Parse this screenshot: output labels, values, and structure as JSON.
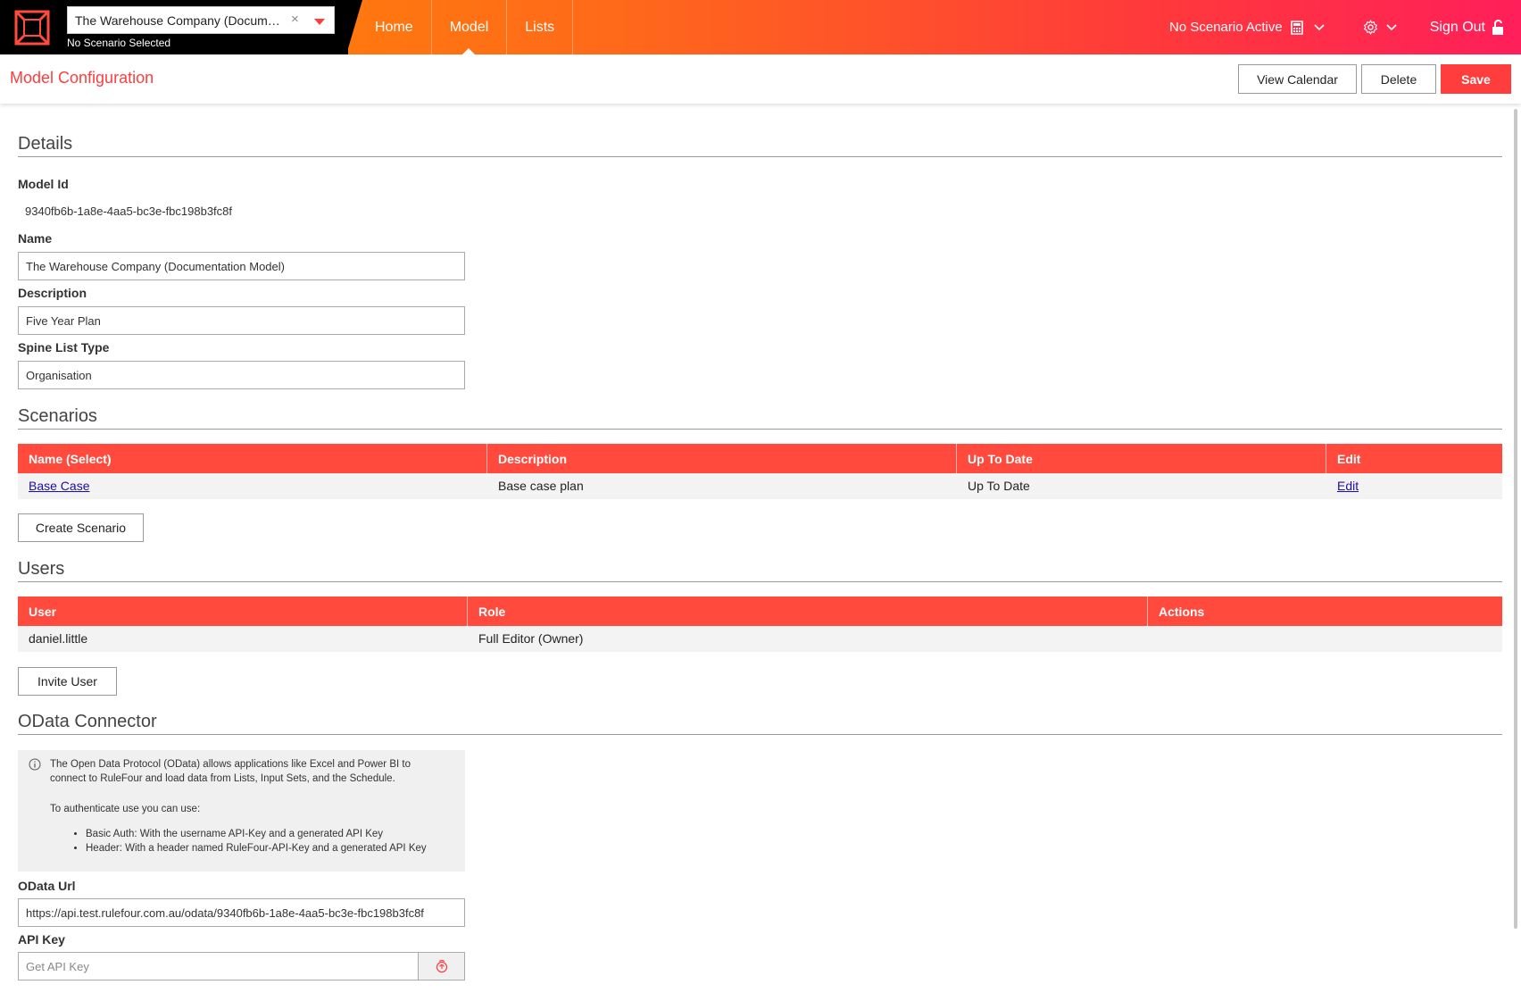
{
  "nav": {
    "model_selector_value": "The Warehouse Company (Documentation Model)",
    "model_selector_clear": "×",
    "scenario_subtitle": "No Scenario Selected",
    "tabs": [
      {
        "label": "Home",
        "active": false
      },
      {
        "label": "Model",
        "active": true
      },
      {
        "label": "Lists",
        "active": false
      }
    ],
    "scenario_status": "No Scenario Active",
    "sign_out": "Sign Out",
    "icons": [
      "calculator-icon",
      "chevron-down-icon",
      "gear-icon",
      "unlock-icon"
    ]
  },
  "page": {
    "title": "Model Configuration",
    "buttons": {
      "view_calendar": "View Calendar",
      "delete": "Delete",
      "save": "Save"
    }
  },
  "details": {
    "heading": "Details",
    "model_id_label": "Model Id",
    "model_id_value": "9340fb6b-1a8e-4aa5-bc3e-fbc198b3fc8f",
    "name_label": "Name",
    "name_value": "The Warehouse Company (Documentation Model)",
    "description_label": "Description",
    "description_value": "Five Year Plan",
    "spine_label": "Spine List Type",
    "spine_value": "Organisation"
  },
  "scenarios": {
    "heading": "Scenarios",
    "columns": [
      "Name (Select)",
      "Description",
      "Up To Date",
      "Edit"
    ],
    "rows": [
      {
        "name": "Base Case",
        "description": "Base case plan",
        "up_to_date": "Up To Date",
        "edit": "Edit"
      }
    ],
    "create_button": "Create Scenario"
  },
  "users": {
    "heading": "Users",
    "columns": [
      "User",
      "Role",
      "Actions"
    ],
    "rows": [
      {
        "user": "daniel.little",
        "role": "Full Editor (Owner)",
        "actions": ""
      }
    ],
    "invite_button": "Invite User"
  },
  "odata": {
    "heading": "OData Connector",
    "info_text": "The Open Data Protocol (OData) allows applications like Excel and Power BI to connect to RuleFour and load data from Lists, Input Sets, and the Schedule.",
    "auth_intro": "To authenticate use you can use:",
    "auth_options": [
      "Basic Auth: With the username API-Key and a generated API Key",
      "Header: With a header named RuleFour-API-Key and a generated API Key"
    ],
    "url_label": "OData Url",
    "url_value": "https://api.test.rulefour.com.au/odata/9340fb6b-1a8e-4aa5-bc3e-fbc198b3fc8f",
    "api_key_label": "API Key",
    "api_key_placeholder": "Get API Key"
  },
  "colors": {
    "accent": "#ff3d3d",
    "gradient_start": "#ff8a00",
    "gradient_end": "#ff1f5a"
  }
}
